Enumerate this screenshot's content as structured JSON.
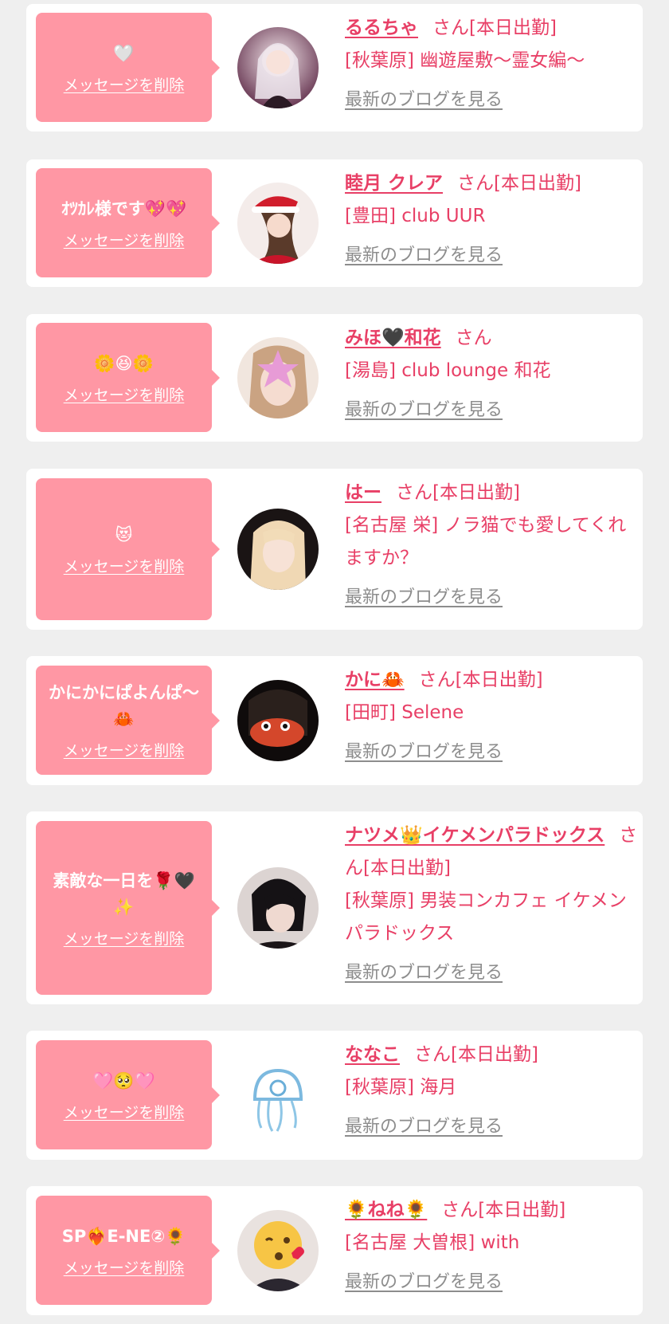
{
  "cards": [
    {
      "message": "🤍",
      "delete_label": "メッセージを削除",
      "name": "るるちゃ",
      "suffix": "さん[本日出勤]",
      "shop": "[秋葉原] 幽遊屋敷〜霊女編〜",
      "blog_label": "最新のブログを見る",
      "avatar": "girl-photo"
    },
    {
      "message": "ｵﾂｶﾚ様です💖💖",
      "delete_label": "メッセージを削除",
      "name": "睦月 クレア",
      "suffix": "さん[本日出勤]",
      "shop": "[豊田] club UUR",
      "blog_label": "最新のブログを見る",
      "avatar": "santa-photo"
    },
    {
      "message": "🌼😆🌼",
      "delete_label": "メッセージを削除",
      "name": "みほ🖤和花",
      "suffix": "さん",
      "shop": "[湯島] club lounge 和花",
      "blog_label": "最新のブログを見る",
      "avatar": "star-face-photo"
    },
    {
      "message": "😻",
      "delete_label": "メッセージを削除",
      "name": "はー",
      "suffix": "さん[本日出勤]",
      "shop": "[名古屋 栄] ノラ猫でも愛してくれますか？",
      "blog_label": "最新のブログを見る",
      "avatar": "blonde-photo"
    },
    {
      "message": "かにかにぱよんぱ〜🦀",
      "delete_label": "メッセージを削除",
      "name": "かに🦀",
      "suffix": "さん[本日出勤]",
      "shop": "[田町] Selene",
      "blog_label": "最新のブログを見る",
      "avatar": "crab-photo"
    },
    {
      "message": "素敵な一日を🌹🖤✨",
      "delete_label": "メッセージを削除",
      "name": "ナツメ👑イケメンパラドックス",
      "suffix": "さん[本日出勤]",
      "shop": "[秋葉原] 男装コンカフェ イケメンパラドックス",
      "blog_label": "最新のブログを見る",
      "avatar": "dark-hair-photo"
    },
    {
      "message": "🩷🥺🩷",
      "delete_label": "メッセージを削除",
      "name": "ななこ",
      "suffix": "さん[本日出勤]",
      "shop": "[秋葉原] 海月",
      "blog_label": "最新のブログを見る",
      "avatar": "jellyfish-logo"
    },
    {
      "message": "SP❤️‍🔥E-NE②🌻",
      "delete_label": "メッセージを削除",
      "name": "🌻ねね🌻",
      "suffix": "さん[本日出勤]",
      "shop": "[名古屋 大曽根] with",
      "blog_label": "最新のブログを見る",
      "avatar": "kiss-emoji-photo"
    }
  ]
}
